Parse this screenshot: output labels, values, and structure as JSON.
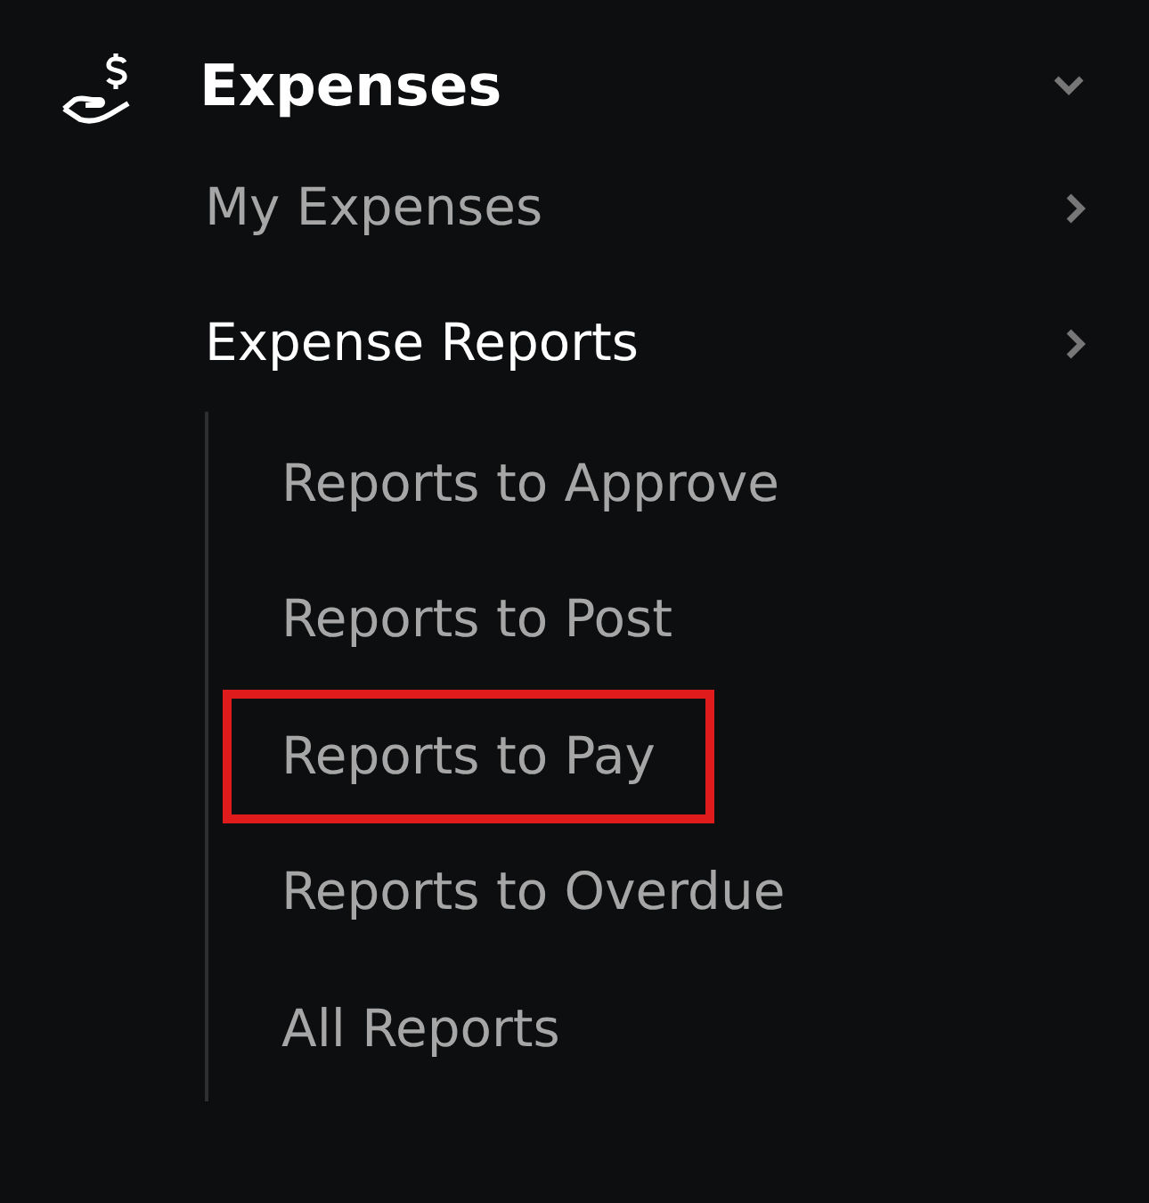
{
  "section": {
    "title": "Expenses",
    "expanded": true
  },
  "items": [
    {
      "label": "My Expenses",
      "selected": false
    },
    {
      "label": "Expense Reports",
      "selected": true,
      "children": [
        {
          "label": "Reports to Approve",
          "highlighted": false
        },
        {
          "label": "Reports to Post",
          "highlighted": false
        },
        {
          "label": "Reports to Pay",
          "highlighted": true
        },
        {
          "label": "Reports to Overdue",
          "highlighted": false
        },
        {
          "label": "All Reports",
          "highlighted": false
        }
      ]
    }
  ]
}
